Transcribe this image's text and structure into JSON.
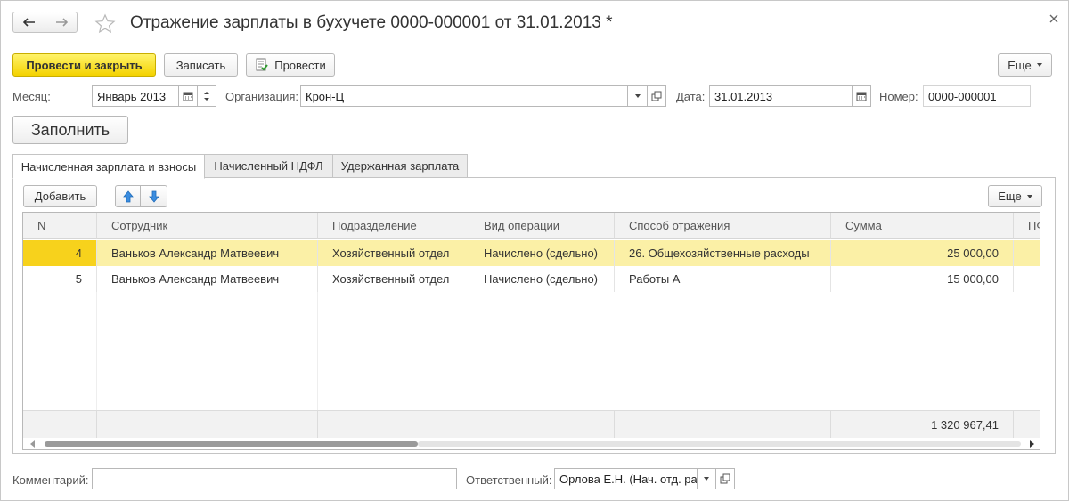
{
  "window": {
    "title": "Отражение зарплаты в бухучете 0000-000001 от 31.01.2013 *"
  },
  "toolbar": {
    "post_close_label": "Провести и закрыть",
    "save_label": "Записать",
    "post_label": "Провести",
    "more_label": "Еще"
  },
  "header": {
    "month_label": "Месяц:",
    "month_value": "Январь 2013",
    "org_label": "Организация:",
    "org_value": "Крон-Ц",
    "date_label": "Дата:",
    "date_value": "31.01.2013",
    "number_label": "Номер:",
    "number_value": "0000-000001"
  },
  "fill_button": "Заполнить",
  "tabs": [
    {
      "label": "Начисленная зарплата и взносы",
      "active": true
    },
    {
      "label": "Начисленный НДФЛ",
      "active": false
    },
    {
      "label": "Удержанная зарплата",
      "active": false
    }
  ],
  "table_toolbar": {
    "add_label": "Добавить",
    "more_label": "Еще"
  },
  "table": {
    "columns": [
      "N",
      "Сотрудник",
      "Подразделение",
      "Вид операции",
      "Способ отражения",
      "Сумма",
      "ПФ"
    ],
    "rows": [
      {
        "n": "4",
        "employee": "Ваньков Александр Матвеевич",
        "department": "Хозяйственный отдел",
        "operation": "Начислено (сдельно)",
        "method": "26. Общехозяйственные расходы",
        "amount": "25 000,00",
        "selected": true
      },
      {
        "n": "5",
        "employee": "Ваньков Александр Матвеевич",
        "department": "Хозяйственный отдел",
        "operation": "Начислено (сдельно)",
        "method": "Работы А",
        "amount": "15 000,00",
        "selected": false
      }
    ],
    "total": "1 320 967,41"
  },
  "footer": {
    "comment_label": "Комментарий:",
    "comment_value": "",
    "responsible_label": "Ответственный:",
    "responsible_value": "Орлова Е.Н. (Нач. отд. ра"
  },
  "colors": {
    "primary_button": "#f4d200",
    "selected_row": "#fbf0a6",
    "selected_cell": "#f7d21c"
  }
}
